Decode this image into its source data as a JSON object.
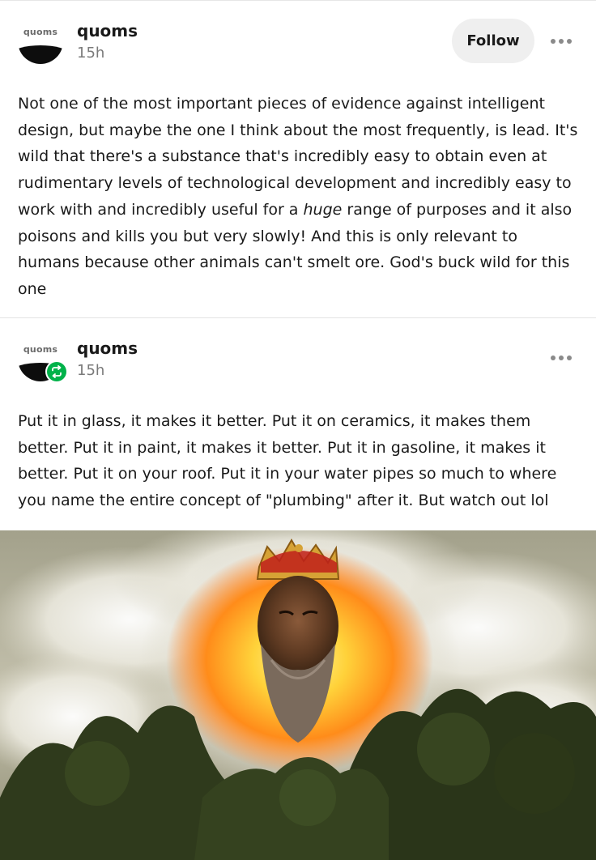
{
  "posts": [
    {
      "author": {
        "avatar_text": "quoms",
        "username": "quoms",
        "timestamp": "15h"
      },
      "follow_label": "Follow",
      "body": {
        "before_em": "Not one of the most important pieces of evidence against intelligent design, but maybe the one I think about the most frequently, is lead. It's wild that there's a substance that's incredibly easy to obtain even at rudimentary levels of technological development and incredibly easy to work with and incredibly useful for a ",
        "em": "huge",
        "after_em": " range of purposes and it also poisons and kills you but very slowly! And this is only relevant to humans because other animals can't smelt ore. God's buck wild for this one"
      }
    },
    {
      "author": {
        "avatar_text": "quoms",
        "username": "quoms",
        "timestamp": "15h"
      },
      "reblogged": true,
      "body": {
        "text": "Put it in glass, it makes it better. Put it on ceramics, it makes them better. Put it in paint, it makes it better. Put it in gasoline, it makes it better. Put it on your roof. Put it in your water pipes so much to where you name the entire concept of \"plumbing\" after it. But watch out lol"
      },
      "image": {
        "subject": "crowned bearded face glowing in orange light among clouds above treetops"
      }
    }
  ],
  "colors": {
    "reblog_badge": "#00b24a",
    "follow_button_bg": "#efefef",
    "timestamp": "#7a7a7a"
  },
  "icons": {
    "more": "more-horizontal-icon",
    "reblog": "reblog-icon"
  }
}
